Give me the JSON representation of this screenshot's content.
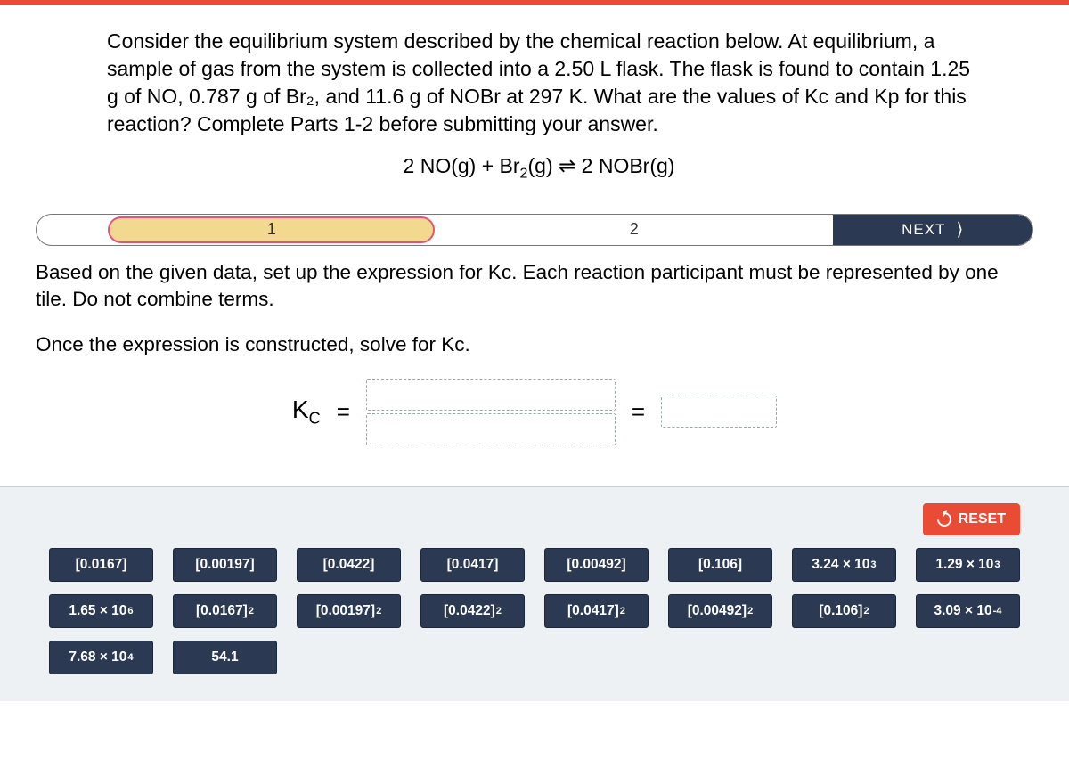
{
  "question": {
    "text": "Consider the equilibrium system described by the chemical reaction below. At equilibrium, a sample of gas from the system is collected into a 2.50 L flask. The flask is found to contain 1.25 g of NO, 0.787 g of Br₂, and 11.6 g of NOBr at 297 K. What are the values of Kc and Kp for this reaction? Complete Parts 1-2 before submitting your answer.",
    "equation_html": "2 NO(g) + Br<span class='sub'>2</span>(g) ⇌ 2 NOBr(g)"
  },
  "progress": {
    "step1": "1",
    "step2": "2",
    "next_label": "NEXT"
  },
  "instructions": {
    "line1": "Based on the given data, set up the expression for Kc. Each reaction participant must be represented by one tile. Do not combine terms.",
    "line2": "Once the expression is constructed, solve for Kc."
  },
  "expression": {
    "kc_html": "K<span class='sub'>C</span>",
    "eq1": "=",
    "eq2": "="
  },
  "reset_label": "RESET",
  "tiles": [
    {
      "html": "[0.0167]"
    },
    {
      "html": "[0.00197]"
    },
    {
      "html": "[0.0422]"
    },
    {
      "html": "[0.0417]"
    },
    {
      "html": "[0.00492]"
    },
    {
      "html": "[0.106]"
    },
    {
      "html": "3.24 × 10<span class='sup3'>3</span>"
    },
    {
      "html": "1.29 × 10<span class='sup3'>3</span>"
    },
    {
      "html": "1.65 × 10<span class='sup6'>6</span>"
    },
    {
      "html": "[0.0167]<span class='sup2'>2</span>"
    },
    {
      "html": "[0.00197]<span class='sup2'>2</span>"
    },
    {
      "html": "[0.0422]<span class='sup2'>2</span>"
    },
    {
      "html": "[0.0417]<span class='sup2'>2</span>"
    },
    {
      "html": "[0.00492]<span class='sup2'>2</span>"
    },
    {
      "html": "[0.106]<span class='sup2'>2</span>"
    },
    {
      "html": "3.09 × 10<span class='supn'>-4</span>"
    },
    {
      "html": "7.68 × 10<span class='sup4'>4</span>"
    },
    {
      "html": "54.1"
    }
  ]
}
